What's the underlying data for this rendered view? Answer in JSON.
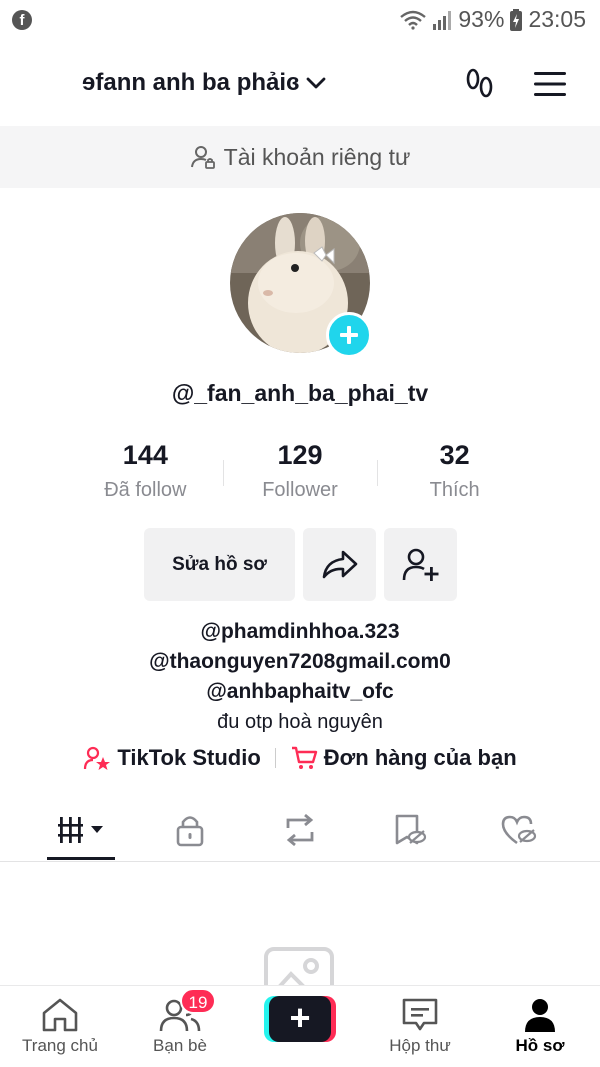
{
  "status_bar": {
    "battery": "93%",
    "time": "23:05"
  },
  "header": {
    "account_name": "ɘfann anh ba phảiɞ"
  },
  "private_banner": {
    "text": "Tài khoản riêng tư"
  },
  "profile": {
    "username": "@_fan_anh_ba_phai_tv"
  },
  "stats": [
    {
      "value": "144",
      "label": "Đã follow"
    },
    {
      "value": "129",
      "label": "Follower"
    },
    {
      "value": "32",
      "label": "Thích"
    }
  ],
  "actions": {
    "edit_label": "Sửa hồ sơ"
  },
  "bio": {
    "lines": [
      "@phamdinhhoa.323",
      "@thaonguyen7208gmail.com0",
      "@anhbaphaitv_ofc"
    ],
    "description": "đu otp hoà nguyên"
  },
  "links": {
    "studio": "TikTok Studio",
    "orders": "Đơn hàng của bạn"
  },
  "bottom_nav": {
    "home": "Trang chủ",
    "friends": "Bạn bè",
    "friends_badge": "19",
    "create": "+",
    "inbox": "Hộp thư",
    "profile": "Hồ sơ"
  },
  "colors": {
    "accent_cyan": "#20d5ec",
    "badge_red": "#fe2c55",
    "text": "#161823",
    "muted": "#8a8b91"
  }
}
